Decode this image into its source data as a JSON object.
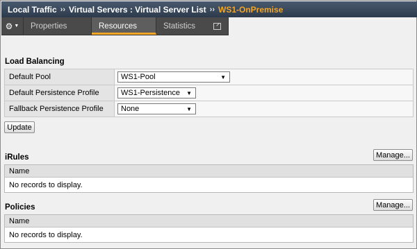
{
  "breadcrumb": {
    "items": [
      "Local Traffic",
      "Virtual Servers : Virtual Server List"
    ],
    "separator": "››",
    "current": "WS1-OnPremise"
  },
  "tabs": {
    "gear_icon": "gear-icon",
    "items": [
      {
        "label": "Properties",
        "active": false
      },
      {
        "label": "Resources",
        "active": true
      },
      {
        "label": "Statistics",
        "active": false
      }
    ]
  },
  "load_balancing": {
    "title": "Load Balancing",
    "rows": [
      {
        "label": "Default Pool",
        "value": "WS1-Pool"
      },
      {
        "label": "Default Persistence Profile",
        "value": "WS1-Persistence"
      },
      {
        "label": "Fallback Persistence Profile",
        "value": "None"
      }
    ],
    "update_label": "Update"
  },
  "irules": {
    "title": "iRules",
    "manage_label": "Manage...",
    "column": "Name",
    "empty": "No records to display."
  },
  "policies": {
    "title": "Policies",
    "manage_label": "Manage...",
    "column": "Name",
    "empty": "No records to display."
  },
  "colors": {
    "accent": "#f5a623",
    "header_bg": "#2c3a4c",
    "tab_bg": "#4a4a4a"
  }
}
